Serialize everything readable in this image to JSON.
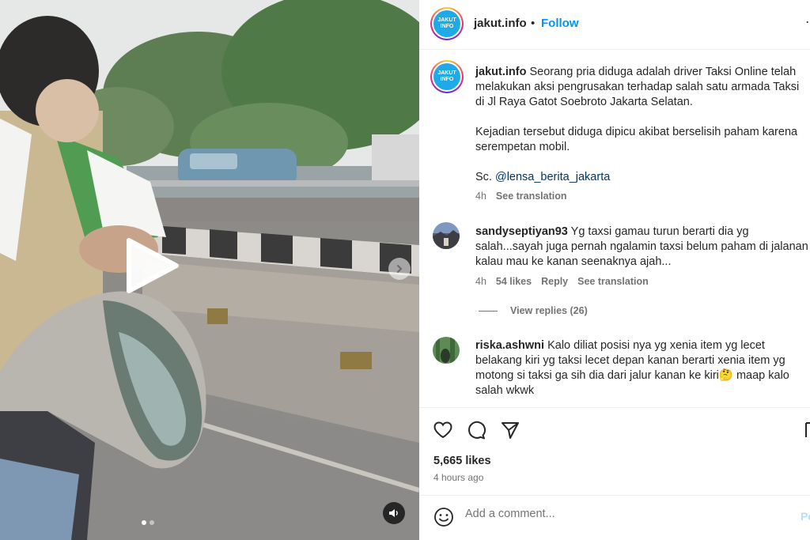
{
  "header": {
    "username": "jakut.info",
    "separator": "•",
    "follow_label": "Follow",
    "more_icon": "more-icon"
  },
  "logo": {
    "line1": "JAKUT",
    "line2": "INFO"
  },
  "caption": {
    "username": "jakut.info",
    "text1": "Seorang pria diduga adalah driver Taksi Online telah melakukan aksi pengrusakan terhadap salah satu armada Taksi di Jl Raya Gatot Soebroto Jakarta Selatan.",
    "text2": "Kejadian tersebut diduga dipicu akibat berselisih paham karena serempetan mobil.",
    "credit_prefix": "Sc.",
    "credit_mention": "@lensa_berita_jakarta",
    "time": "4h",
    "see_translation": "See translation"
  },
  "comments": [
    {
      "username": "sandyseptiyan93",
      "text": "Yg taxsi gamau turun berarti dia yg salah...sayah juga pernah ngalamin taxsi belum paham di jalanan kalau mau ke kanan seenaknya ajah...",
      "time": "4h",
      "likes": "54 likes",
      "reply": "Reply",
      "see_translation": "See translation",
      "view_replies": "View replies (26)"
    },
    {
      "username": "riska.ashwni",
      "text": "Kalo diliat posisi nya yg xenia item yg lecet belakang kiri yg taksi lecet depan kanan berarti xenia item yg motong si taksi ga sih dia dari jalur kanan ke kiri🤔 maap kalo salah wkwk"
    }
  ],
  "actions": {
    "likes": "5,665 likes",
    "time_ago": "4 hours ago"
  },
  "composer": {
    "placeholder": "Add a comment...",
    "post_label": "Post"
  },
  "media": {
    "slides": 2,
    "active_slide": 1
  }
}
